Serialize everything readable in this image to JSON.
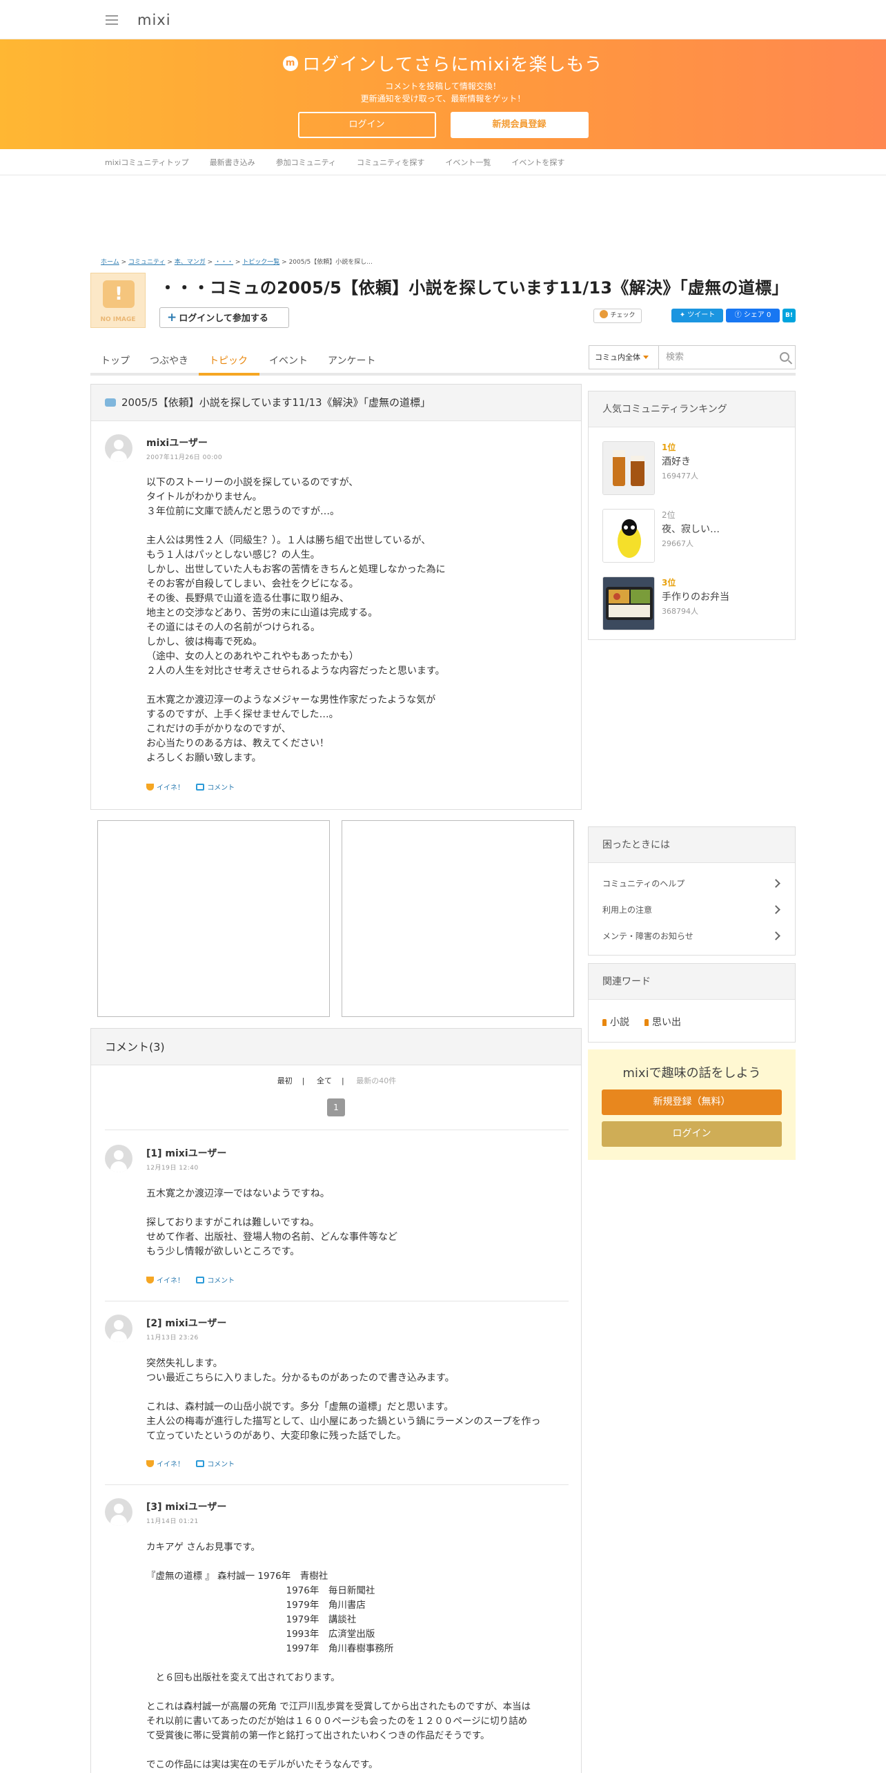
{
  "header": {
    "logo": "mixi"
  },
  "banner": {
    "title": "ログインしてさらにmixiを楽しもう",
    "sub1": "コメントを投稿して情報交換！",
    "sub2": "更新通知を受け取って、最新情報をゲット！",
    "login": "ログイン",
    "register": "新規会員登録"
  },
  "subnav": [
    "mixiコミュニティトップ",
    "最新書き込み",
    "参加コミュニティ",
    "コミュニティを探す",
    "イベント一覧",
    "イベントを探す"
  ],
  "breadcrumb": {
    "home": "ホーム",
    "community": "コミュニティ",
    "genre": "本、マンガ",
    "comm": "・・・",
    "topics": "トピック一覧",
    "current": "2005/5【依頼】小説を探し..."
  },
  "community": {
    "noimage": "NO IMAGE",
    "title": "・・・コミュの2005/5【依頼】小説を探しています11/13《解決》「虚無の道標」",
    "join": "ログインして参加する",
    "check": "チェック",
    "tweet": "ツイート",
    "share": "シェア 0",
    "hatena": "B!"
  },
  "tabs": [
    "トップ",
    "つぶやき",
    "トピック",
    "イベント",
    "アンケート"
  ],
  "search": {
    "scope": "コミュ内全体",
    "placeholder": "検索"
  },
  "topic": {
    "title": "2005/5【依頼】小説を探しています11/13《解決》「虚無の道標」",
    "user": "mixiユーザー",
    "date": "2007年11月26日 00:00",
    "body": "以下のストーリーの小説を探しているのですが、\nタイトルがわかりません。\n３年位前に文庫で読んだと思うのですが…。\n\n主人公は男性２人（同級生？）。１人は勝ち組で出世しているが、\nもう１人はパッとしない感じ？の人生。\nしかし、出世していた人もお客の苦情をきちんと処理しなかった為に\nそのお客が自殺してしまい、会社をクビになる。\nその後、長野県で山道を造る仕事に取り組み、\n地主との交渉などあり、苦労の末に山道は完成する。\nその道にはその人の名前がつけられる。\nしかし、彼は梅毒で死ぬ。\n（途中、女の人とのあれやこれやもあったかも）\n２人の人生を対比させ考えさせられるような内容だったと思います。\n\n五木寛之か渡辺淳一のようなメジャーな男性作家だったような気が\nするのですが、上手く探せませんでした…。\nこれだけの手がかりなのですが、\nお心当たりのある方は、教えてください！\nよろしくお願い致します。",
    "like": "イイネ！",
    "comment": "コメント"
  },
  "comments": {
    "header": "コメント(3)",
    "pager": {
      "first": "最初",
      "all": "全て",
      "latest": "最新の40件",
      "page": "1"
    },
    "items": [
      {
        "user": "[1] mixiユーザー",
        "date": "12月19日 12:40",
        "body": "五木寛之か渡辺淳一ではないようですね。\n\n探しておりますがこれは難しいですね。\nせめて作者、出版社、登場人物の名前、どんな事件等など\nもう少し情報が欲しいところです。"
      },
      {
        "user": "[2] mixiユーザー",
        "date": "11月13日 23:26",
        "body": "突然失礼します。\nつい最近こちらに入りました。分かるものがあったので書き込みます。\n\nこれは、森村誠一の山岳小説です。多分「虚無の道標」だと思います。\n主人公の梅毒が進行した描写として、山小屋にあった鍋という鍋にラーメンのスープを作っ\nて立っていたというのがあり、大変印象に残った話でした。"
      },
      {
        "user": "[3] mixiユーザー",
        "date": "11月14日 01:21",
        "body": "カキアゲ さんお見事です。\n\n『虚無の道標 』 森村誠一 1976年　青樹社\n　　　　　　　　　　　　　　　1976年　毎日新聞社\n　　　　　　　　　　　　　　　1979年　角川書店\n　　　　　　　　　　　　　　　1979年　講談社\n　　　　　　　　　　　　　　　1993年　広済堂出版\n　　　　　　　　　　　　　　　1997年　角川春樹事務所\n\n　と６回も出版社を変えて出されております。\n\nとこれは森村誠一が高層の死角 で江戸川乱歩賞を受賞してから出されたものですが、本当は\nそれ以前に書いてあったのだが始は１６００ページも会ったのを１２００ページに切り詰め\nて受賞後に帯に受賞前の第一作と銘打って出されたいわくつきの作品だそうです。\n\nでこの作品には実は実在のモデルがいたそうなんです。"
      }
    ],
    "like": "イイネ！",
    "comment": "コメント"
  },
  "ranking": {
    "header": "人気コミュニティランキング",
    "items": [
      {
        "pos": "1位",
        "name": "酒好き",
        "count": "169477人"
      },
      {
        "pos": "2位",
        "name": "夜、寂しい…",
        "count": "29667人"
      },
      {
        "pos": "3位",
        "name": "手作りのお弁当",
        "count": "368794人"
      }
    ]
  },
  "help": {
    "header": "困ったときには",
    "links": [
      "コミュニティのヘルプ",
      "利用上の注意",
      "メンテ・障害のお知らせ"
    ]
  },
  "keywords": {
    "header": "関連ワード",
    "items": [
      "小説",
      "思い出"
    ]
  },
  "promo": {
    "title": "mixiで趣味の話をしよう",
    "register": "新規登録（無料）",
    "login": "ログイン"
  },
  "colors": {
    "accent": "#f5a623",
    "link": "#2a7ab0",
    "banner_start": "#ffb733",
    "banner_end": "#ff8850"
  }
}
